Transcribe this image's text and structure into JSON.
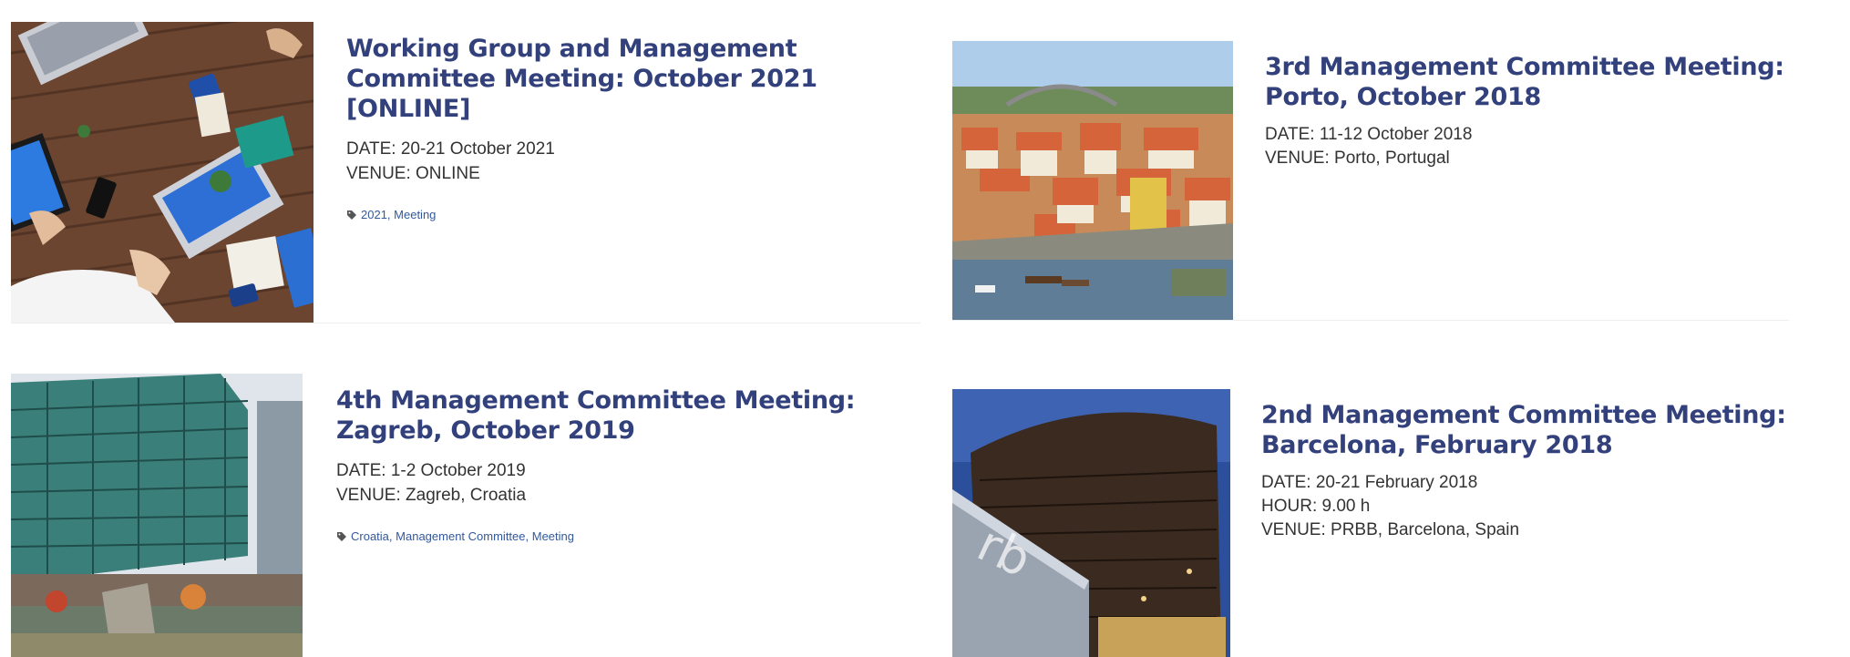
{
  "events": [
    {
      "title": "Working Group and Management Committee Meeting: October 2021 [ONLINE]",
      "meta": [
        "DATE: 20-21 October 2021",
        "VENUE: ONLINE"
      ],
      "tags": [
        "2021",
        "Meeting"
      ],
      "image": "office-desk-photo"
    },
    {
      "title": "3rd Management Committee Meeting: Porto, October 2018",
      "meta": [
        "DATE: 11-12 October 2018",
        "VENUE: Porto, Portugal"
      ],
      "tags": [],
      "image": "porto-city-photo"
    },
    {
      "title": "4th Management Committee Meeting: Zagreb, October 2019",
      "meta": [
        "DATE: 1-2 October 2019",
        "VENUE: Zagreb, Croatia"
      ],
      "tags": [
        "Croatia",
        "Management Committee",
        "Meeting"
      ],
      "image": "zagreb-building-photo"
    },
    {
      "title": "2nd Management Committee Meeting: Barcelona, February 2018",
      "meta": [
        "DATE: 20-21 February 2018",
        "HOUR: 9.00 h",
        "VENUE: PRBB, Barcelona, Spain"
      ],
      "tags": [],
      "image": "prbb-building-photo"
    }
  ],
  "colors": {
    "title": "#32407b",
    "text": "#333333",
    "tag_link": "#33589b"
  },
  "tag_icon": "tag-icon"
}
